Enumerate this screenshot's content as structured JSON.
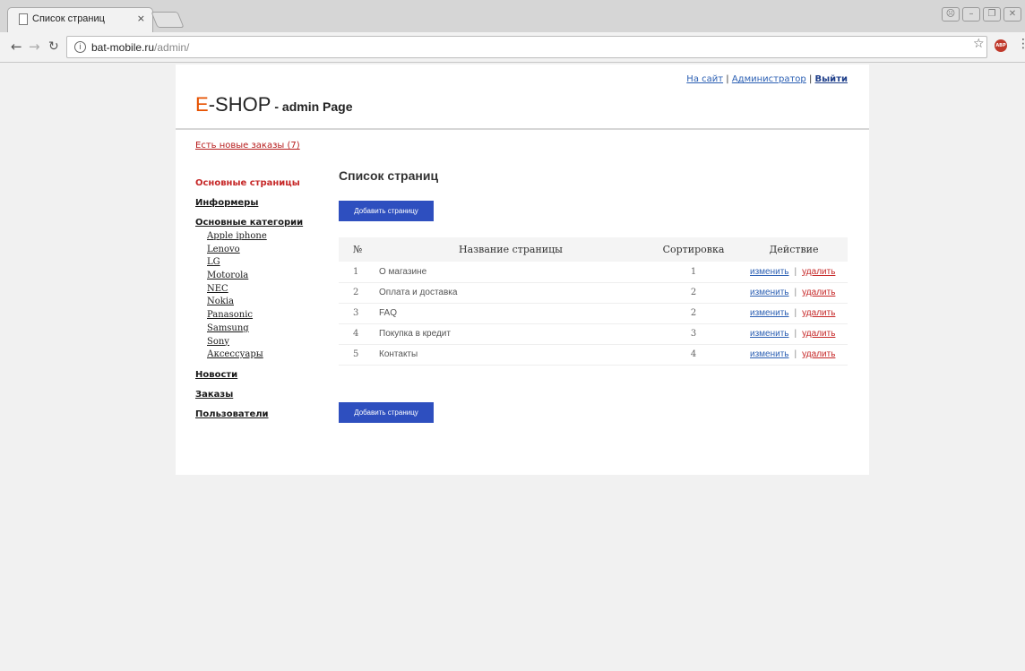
{
  "browser": {
    "tab_title": "Список страниц",
    "tab_close": "×",
    "url_host": "bat-mobile.ru",
    "url_path": "/admin/",
    "extension_badge": "ABP"
  },
  "header": {
    "logo_e": "E",
    "logo_shop": "-SHOP",
    "logo_sub": "- admin Page",
    "links": {
      "to_site": "На сайт",
      "separator": "|",
      "admin": "Администратор",
      "logout": "Выйти"
    }
  },
  "orders_alert": "Есть новые заказы (7)",
  "sidebar": {
    "main_pages": "Основные страницы",
    "informers": "Информеры",
    "categories": "Основные категории",
    "subcategories": [
      "Apple iphone",
      "Lenovo",
      "LG",
      "Motorola",
      "NEC",
      "Nokia",
      "Panasonic",
      "Samsung",
      "Sony",
      "Аксессуары"
    ],
    "news": "Новости",
    "orders": "Заказы",
    "users": "Пользователи"
  },
  "content": {
    "title": "Список страниц",
    "add_button": "Добавить страницу",
    "table": {
      "headers": [
        "№",
        "Название страницы",
        "Сортировка",
        "Действие"
      ],
      "edit_label": "изменить",
      "delete_label": "удалить",
      "action_separator": "|",
      "rows": [
        {
          "num": "1",
          "name": "О магазине",
          "sort": "1"
        },
        {
          "num": "2",
          "name": "Оплата и доставка",
          "sort": "2"
        },
        {
          "num": "3",
          "name": "FAQ",
          "sort": "2"
        },
        {
          "num": "4",
          "name": "Покупка в кредит",
          "sort": "3"
        },
        {
          "num": "5",
          "name": "Контакты",
          "sort": "4"
        }
      ]
    }
  },
  "colors": {
    "accent_blue": "#2e4fbf",
    "logo_orange": "#e65100",
    "alert_red": "#c62828",
    "link_blue": "#2b5fb3"
  }
}
